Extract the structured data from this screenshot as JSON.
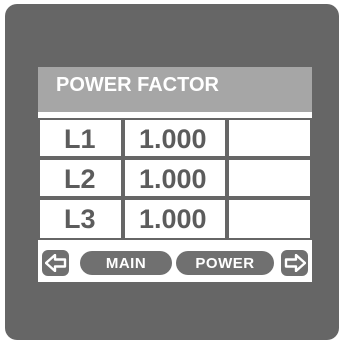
{
  "screen": {
    "title": "POWER FACTOR"
  },
  "rows": [
    {
      "label": "L1",
      "value": "1.000"
    },
    {
      "label": "L2",
      "value": "1.000"
    },
    {
      "label": "L3",
      "value": "1.000"
    }
  ],
  "nav": {
    "left_icon": "arrow-left-icon",
    "main_label": "MAIN",
    "power_label": "POWER",
    "right_icon": "arrow-right-icon"
  },
  "colors": {
    "bezel": "#666666",
    "title_bar": "#a6a6a6",
    "text": "#5c5c5c",
    "button": "#707070"
  }
}
